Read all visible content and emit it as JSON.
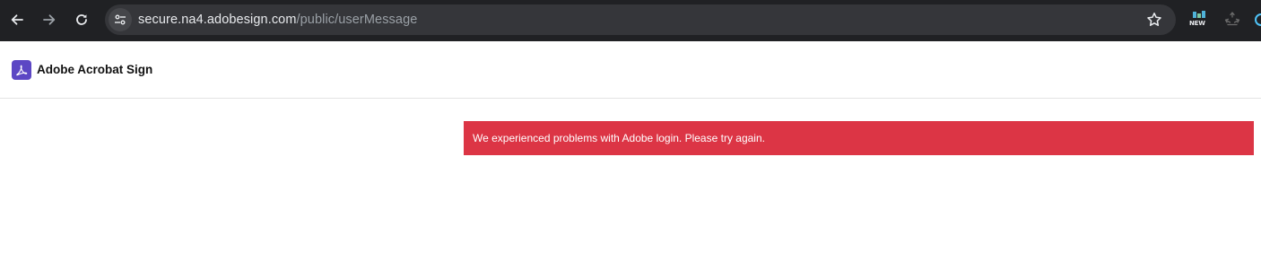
{
  "browser": {
    "url_host": "secure.na4.adobesign.com",
    "url_path": "/public/userMessage",
    "extension_badge": "NEW",
    "icons": {
      "back": "arrow-left-icon",
      "forward": "arrow-right-icon",
      "reload": "reload-icon",
      "site_info": "tune-icon",
      "bookmark": "star-icon",
      "ext_new": "new-badge-icon",
      "ext_recycle": "recycle-icon",
      "ext_partial": "extension-icon"
    }
  },
  "header": {
    "app_name": "Adobe Acrobat Sign",
    "logo_icon": "adobe-acrobat-icon",
    "brand_color": "#5c47c4"
  },
  "message": {
    "text": "We experienced problems with Adobe login. Please try again.",
    "color": "#dc3545",
    "kind": "error"
  }
}
